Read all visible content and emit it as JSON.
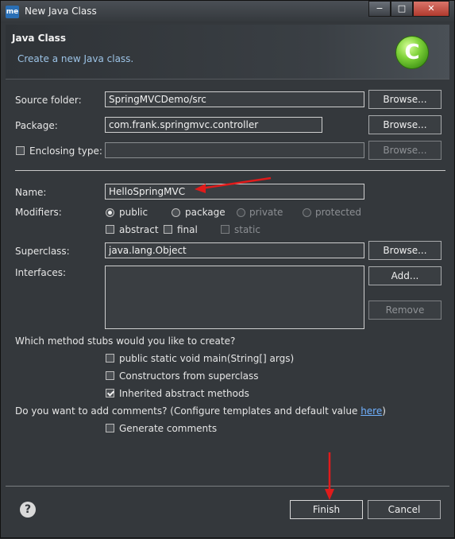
{
  "window": {
    "title": "New Java Class",
    "app_icon": "me",
    "minimize": "−",
    "maximize": "□",
    "close": "✕"
  },
  "banner": {
    "title": "Java Class",
    "description": "Create a new Java class.",
    "logo_letter": "C"
  },
  "form": {
    "source_folder": {
      "label": "Source folder:",
      "value": "SpringMVCDemo/src",
      "browse": "Browse..."
    },
    "package": {
      "label": "Package:",
      "value": "com.frank.springmvc.controller",
      "browse": "Browse..."
    },
    "enclosing_type": {
      "label": "Enclosing type:",
      "value": "",
      "browse": "Browse..."
    },
    "name": {
      "label": "Name:",
      "value": "HelloSpringMVC"
    },
    "modifiers": {
      "label": "Modifiers:",
      "public": "public",
      "package": "package",
      "private": "private",
      "protected": "protected",
      "abstract": "abstract",
      "final": "final",
      "static": "static"
    },
    "superclass": {
      "label": "Superclass:",
      "value": "java.lang.Object",
      "browse": "Browse..."
    },
    "interfaces": {
      "label": "Interfaces:",
      "add": "Add...",
      "remove": "Remove"
    },
    "stubs": {
      "question": "Which method stubs would you like to create?",
      "main": "public static void main(String[] args)",
      "constructors": "Constructors from superclass",
      "inherited": "Inherited abstract methods"
    },
    "comments": {
      "question_prefix": "Do you want to add comments? (Configure templates and default value ",
      "link": "here",
      "question_suffix": ")",
      "generate": "Generate comments"
    }
  },
  "footer": {
    "help": "?",
    "finish": "Finish",
    "cancel": "Cancel"
  },
  "colors": {
    "annotation_arrow": "#e01b1b"
  }
}
